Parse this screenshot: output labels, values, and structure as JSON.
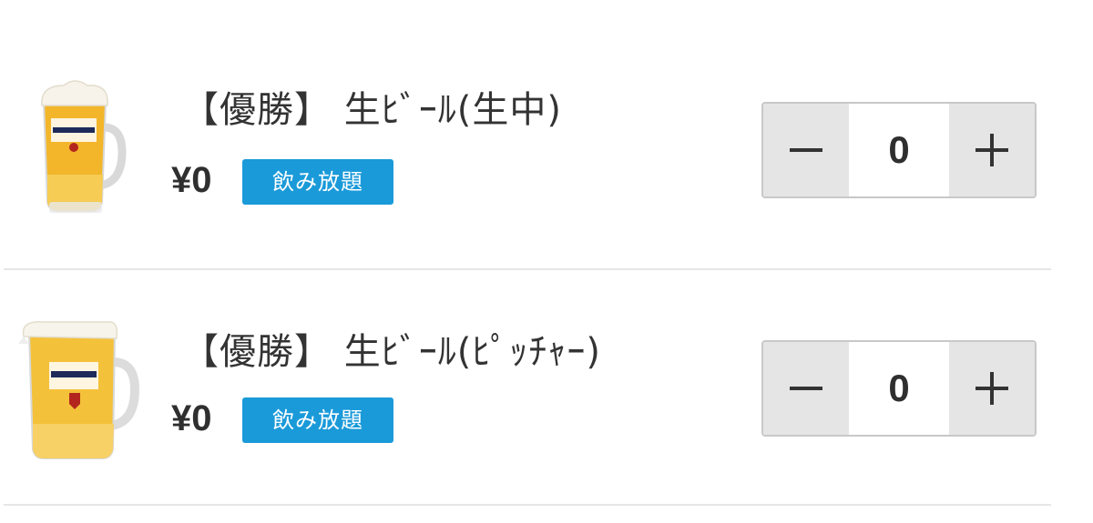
{
  "menu": {
    "items": [
      {
        "title": "【優勝】 生ﾋﾞｰﾙ(生中)",
        "price": "¥0",
        "badge": "飲み放題",
        "quantity": "0",
        "image_icon": "beer-mug-icon"
      },
      {
        "title": "【優勝】 生ﾋﾞｰﾙ(ﾋﾟｯﾁｬｰ)",
        "price": "¥0",
        "badge": "飲み放題",
        "quantity": "0",
        "image_icon": "beer-pitcher-icon"
      }
    ]
  },
  "colors": {
    "badge": "#1a9ad9",
    "stepper_button": "#e5e5e5",
    "stepper_border": "#c8c8c8",
    "divider": "#e6e6e6"
  },
  "icons": {
    "decrement": "minus-icon",
    "increment": "plus-icon"
  }
}
